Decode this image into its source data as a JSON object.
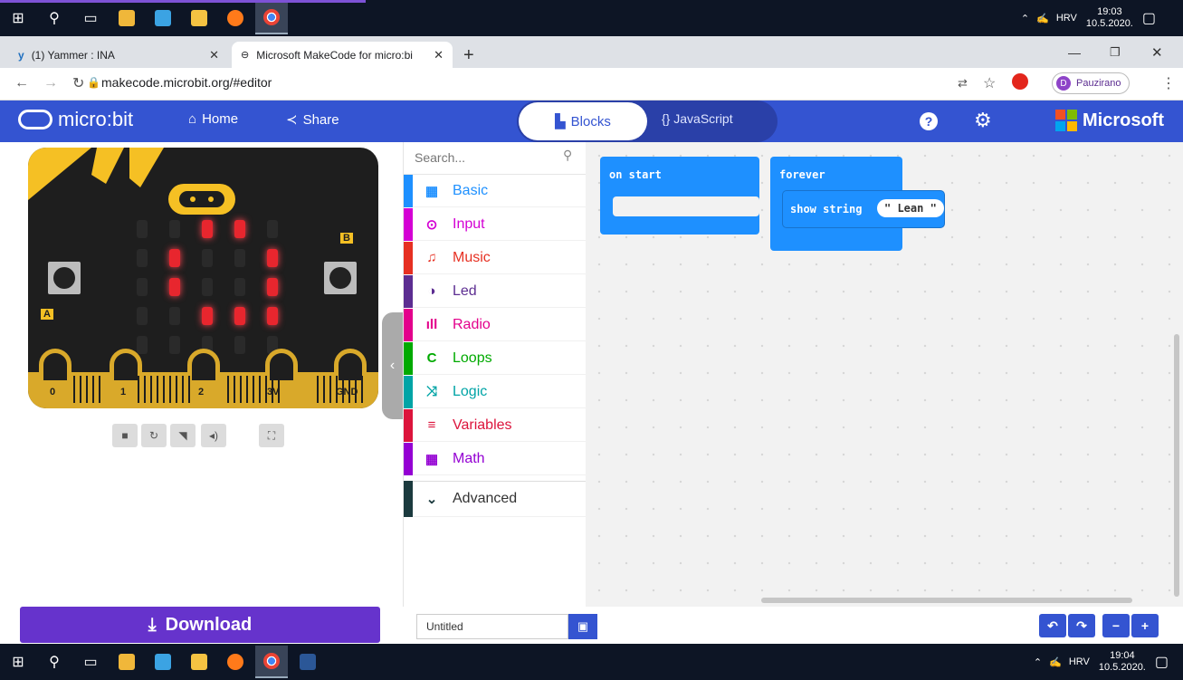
{
  "taskbar_top": {
    "tray": {
      "language": "HRV",
      "time": "19:03",
      "date": "10.5.2020."
    }
  },
  "taskbar_bottom": {
    "tray": {
      "language": "HRV",
      "time": "19:04",
      "date": "10.5.2020."
    }
  },
  "browser": {
    "tabs": [
      {
        "label": "(1) Yammer : INA"
      },
      {
        "label": "Microsoft MakeCode for micro:bi"
      }
    ],
    "new_tab": "+",
    "url": "makecode.microbit.org/#editor",
    "profile": "Pauzirano",
    "profile_initial": "D"
  },
  "header": {
    "logo": "micro:bit",
    "home": "Home",
    "share": "Share",
    "blocks": "Blocks",
    "javascript": "{} JavaScript",
    "brand": "Microsoft"
  },
  "simulator": {
    "pins": [
      "0",
      "1",
      "2",
      "3V",
      "GND"
    ],
    "button_a": "A",
    "button_b": "B"
  },
  "toolbox": {
    "search_placeholder": "Search...",
    "categories": [
      {
        "label": "Basic",
        "color": "#1e90ff"
      },
      {
        "label": "Input",
        "color": "#d400d4"
      },
      {
        "label": "Music",
        "color": "#e63022"
      },
      {
        "label": "Led",
        "color": "#5c2d91"
      },
      {
        "label": "Radio",
        "color": "#e3008c"
      },
      {
        "label": "Loops",
        "color": "#00aa00"
      },
      {
        "label": "Logic",
        "color": "#00a4a6"
      },
      {
        "label": "Variables",
        "color": "#dc143c"
      },
      {
        "label": "Math",
        "color": "#9400d3"
      }
    ],
    "advanced": "Advanced",
    "advanced_color": "#1b3a3e"
  },
  "workspace": {
    "on_start": "on start",
    "forever": "forever",
    "show_string": "show string",
    "string_value": "\" Lean \""
  },
  "bottom": {
    "download": "Download",
    "project_name": "Untitled"
  }
}
